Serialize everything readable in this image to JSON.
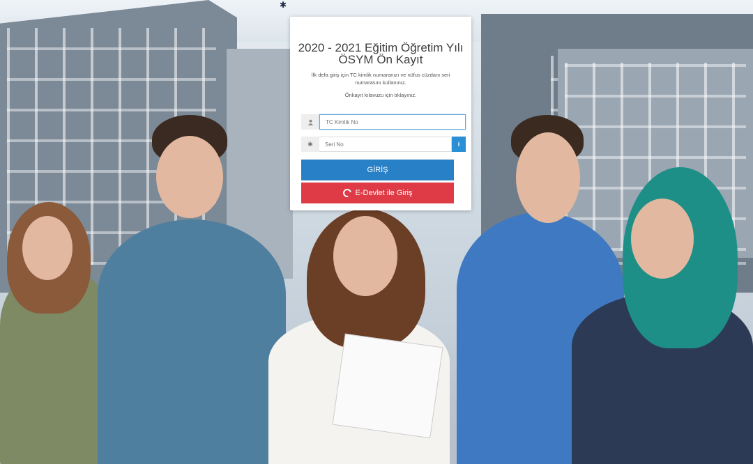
{
  "card": {
    "title": "2020 - 2021 Eğitim Öğretim Yılı ÖSYM Ön Kayıt",
    "subtitle": "İlk defa giriş için TC kimlik numaranızı ve nüfus cüzdanı seri numarasını kullanınız.",
    "guide_link": "Önkayıt kılavuzu için tıklayınız."
  },
  "form": {
    "tc_placeholder": "TC Kimlik No",
    "serial_placeholder": "Seri No",
    "info_label": "i",
    "login_button": "GİRİŞ",
    "edevlet_button": "E-Devlet ile Giriş"
  },
  "icons": {
    "user": "user-icon",
    "asterisk": "asterisk-icon",
    "info": "info-icon",
    "edevlet": "edevlet-logo-icon"
  },
  "colors": {
    "primary": "#2880c7",
    "danger": "#de3b46",
    "info": "#2b8fd6"
  }
}
